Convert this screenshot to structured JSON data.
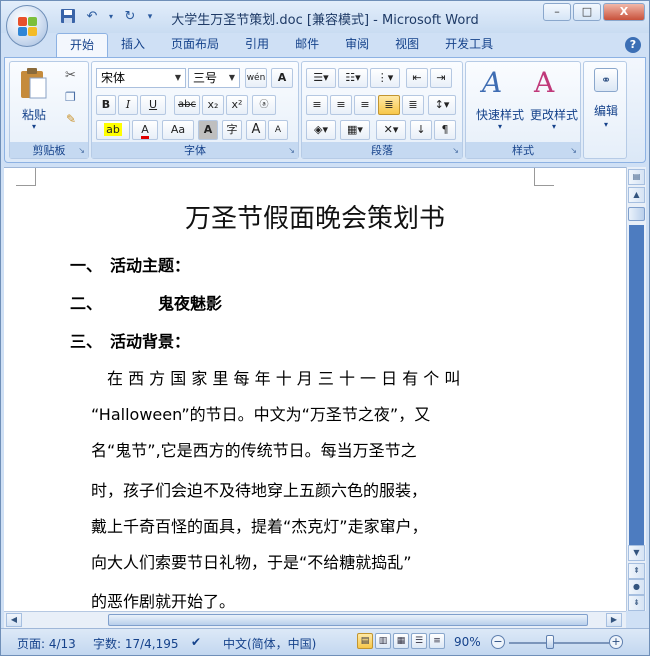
{
  "window": {
    "title": "大学生万圣节策划.doc [兼容模式] - Microsoft Word",
    "controls": {
      "minimize": "–",
      "maximize": "□",
      "close": "X"
    }
  },
  "quick_access": {
    "save_icon": "save-icon",
    "undo_icon": "undo-icon",
    "redo_icon": "redo-icon",
    "more": "▾"
  },
  "tabs": [
    {
      "label": "开始",
      "active": true
    },
    {
      "label": "插入"
    },
    {
      "label": "页面布局"
    },
    {
      "label": "引用"
    },
    {
      "label": "邮件"
    },
    {
      "label": "审阅"
    },
    {
      "label": "视图"
    },
    {
      "label": "开发工具"
    }
  ],
  "ribbon": {
    "clipboard": {
      "label": "剪贴板",
      "paste": "粘贴"
    },
    "font": {
      "label": "字体",
      "font_name": "宋体",
      "font_size": "三号",
      "wen": "wén",
      "bold": "B",
      "italic": "I",
      "underline": "U",
      "strike": "abc",
      "subscript": "x₂",
      "superscript": "x²",
      "font_color": "A",
      "case": "Aa",
      "grow": "A",
      "shrink": "A",
      "char_border": "A",
      "phonetic": "字"
    },
    "paragraph": {
      "label": "段落"
    },
    "styles": {
      "label": "样式",
      "quick_styles": "快速样式",
      "change_styles": "更改样式"
    },
    "editing": {
      "label": "编辑"
    }
  },
  "document": {
    "title": "万圣节假面晚会策划书",
    "headings": [
      {
        "num": "一、",
        "text": "活动主题："
      },
      {
        "num": "二、",
        "text": "鬼夜魅影"
      },
      {
        "num": "三、",
        "text": "活动背景："
      }
    ],
    "lines": [
      "在 西 方 国 家 里 每 年 十 月 三 十 一 日 有 个 叫",
      "“Halloween”的节日。中文为“万圣节之夜”，又",
      "名“鬼节”,它是西方的传统节日。每当万圣节之",
      "时，孩子们会迫不及待地穿上五颜六色的服装，",
      "戴上千奇百怪的面具，提着“杰克灯”走家窜户，",
      "向大人们索要节日礼物，于是“不给糖就捣乱”",
      "的恶作剧就开始了。"
    ]
  },
  "status": {
    "page": "页面: 4/13",
    "words": "字数: 17/4,195",
    "language": "中文(简体，中国)",
    "zoom": "90%"
  }
}
